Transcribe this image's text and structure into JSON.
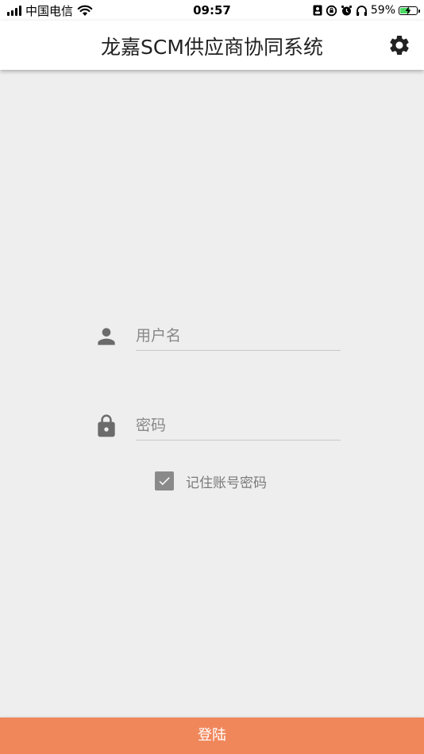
{
  "status_bar": {
    "carrier": "中国电信",
    "time": "09:57",
    "battery_percent": "59%",
    "battery_level": 0.59,
    "icons": [
      "signal-icon",
      "wifi-icon",
      "contact-icon",
      "rotation-lock-icon",
      "alarm-icon",
      "headphones-icon",
      "battery-icon"
    ]
  },
  "app_bar": {
    "title": "龙嘉SCM供应商协同系统",
    "settings_icon": "gear-icon"
  },
  "form": {
    "username": {
      "placeholder": "用户名",
      "value": "",
      "icon": "person-icon"
    },
    "password": {
      "placeholder": "密码",
      "value": "",
      "icon": "lock-icon"
    },
    "remember": {
      "label": "记住账号密码",
      "checked": true
    }
  },
  "login_button": {
    "label": "登陆"
  },
  "colors": {
    "background": "#eeeeee",
    "app_bar": "#ffffff",
    "accent": "#f0875b",
    "icon": "#6b6b6b",
    "checkbox": "#8a8a8a"
  }
}
